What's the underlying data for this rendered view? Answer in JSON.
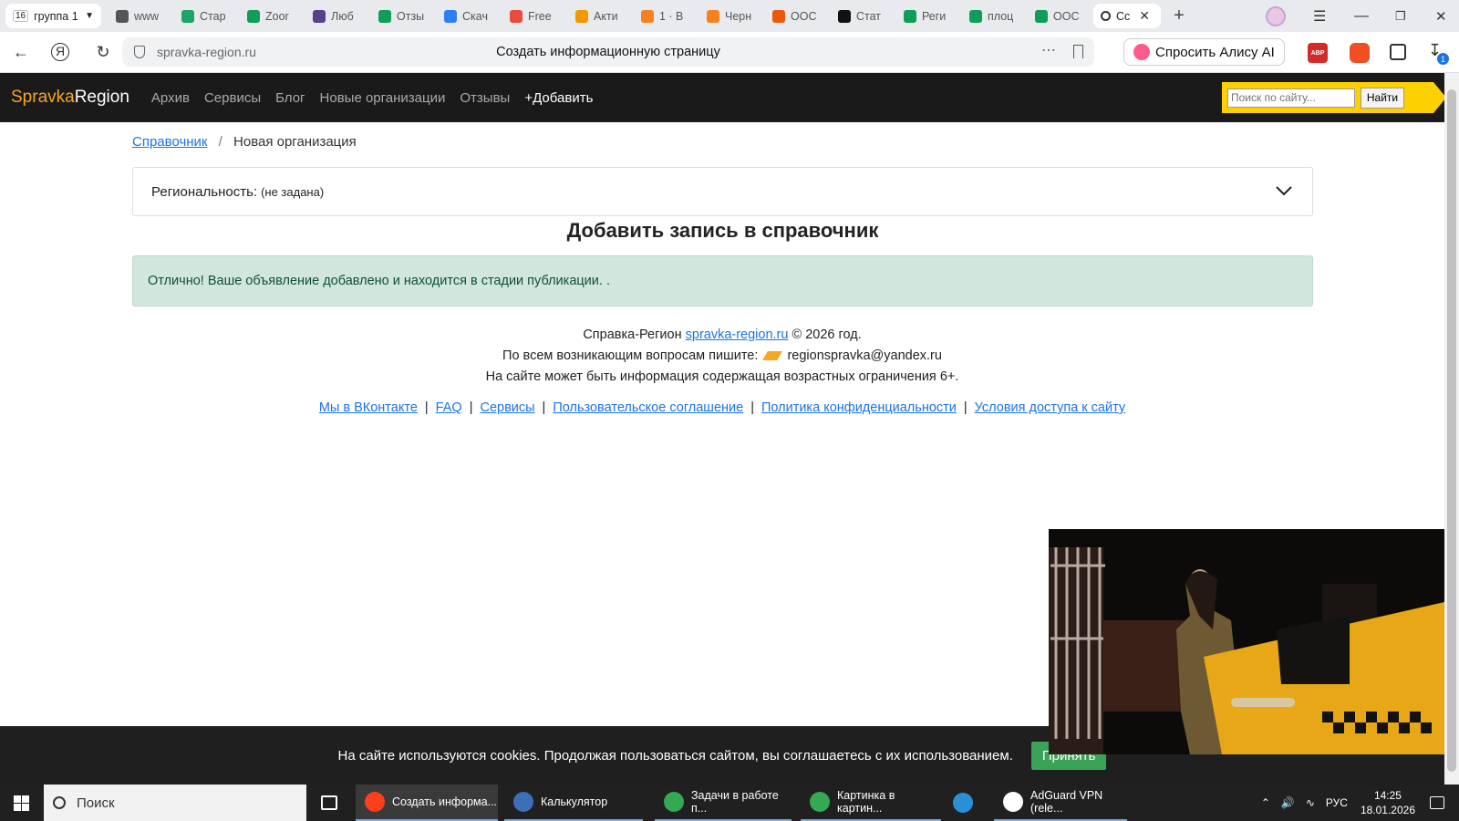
{
  "browser": {
    "tab_group": {
      "count": "16",
      "label": "группа 1"
    },
    "tabs": [
      {
        "label": "www",
        "icon": "doc-icon",
        "color": "#555555"
      },
      {
        "label": "Стар",
        "icon": "drive-icon",
        "color": "#1fa463"
      },
      {
        "label": "Zoor",
        "icon": "sheets-icon",
        "color": "#0f9d58"
      },
      {
        "label": "Люб",
        "icon": "circle-icon",
        "color": "#5b3f8c"
      },
      {
        "label": "Отзы",
        "icon": "sheets-icon",
        "color": "#0f9d58"
      },
      {
        "label": "Скач",
        "icon": "heart-icon",
        "color": "#2d7ff9"
      },
      {
        "label": "Free",
        "icon": "free-icon",
        "color": "#e94b3c"
      },
      {
        "label": "Акти",
        "icon": "chat-icon",
        "color": "#f29900"
      },
      {
        "label": "1 · В",
        "icon": "mail-icon",
        "color": "#f58220"
      },
      {
        "label": "Черн",
        "icon": "mail-icon",
        "color": "#f58220"
      },
      {
        "label": "ООС",
        "icon": "fire-icon",
        "color": "#ea5a0c"
      },
      {
        "label": "Стат",
        "icon": "k-icon",
        "color": "#111111"
      },
      {
        "label": "Реги",
        "icon": "sheets-icon",
        "color": "#0f9d58"
      },
      {
        "label": "плоц",
        "icon": "sheets-icon",
        "color": "#0f9d58"
      },
      {
        "label": "ООС",
        "icon": "sheets-icon",
        "color": "#0f9d58"
      }
    ],
    "active_tab": {
      "label": "Сс",
      "icon": "pin-icon"
    },
    "url": "spravka-region.ru",
    "page_title": "Создать информационную страницу",
    "alisa_label": "Спросить Алису AI",
    "ext_abp": "ABP",
    "downloads_badge": "1"
  },
  "site": {
    "logo_a": "Spravka",
    "logo_b": "Region",
    "nav": [
      "Архив",
      "Сервисы",
      "Блог",
      "Новые организации",
      "Отзывы",
      "+Добавить"
    ],
    "search_placeholder": "Поиск по сайту...",
    "search_button": "Найти",
    "breadcrumb": {
      "home": "Справочник",
      "sep": "/",
      "current": "Новая организация"
    },
    "region_label": "Региональность:",
    "region_value": "(не задана)",
    "heading": "Добавить запись в справочник",
    "alert": "Отлично! Ваше объявление добавлено и находится в стадии публикации. .",
    "footer": {
      "line1_prefix": "Справка-Регион",
      "line1_link": "spravka-region.ru",
      "line1_suffix": "© 2026 год.",
      "line2_prefix": "По всем возникающим вопросам пишите:",
      "email": "regionspravka@yandex.ru",
      "line3": "На сайте может быть информация содержащая возрастных ограничения 6+.",
      "links": [
        "Мы в ВКонтакте",
        "FAQ",
        "Сервисы",
        "Пользовательское соглашение",
        "Политика конфиденциальности",
        "Условия доступа к сайту"
      ],
      "sep": "|"
    },
    "cookie_text": "На сайте используются cookies. Продолжая пользоваться сайтом, вы соглашаетесь с их использованием.",
    "cookie_button": "Принять"
  },
  "taskbar": {
    "search": "Поиск",
    "apps": [
      {
        "label": "Создать информа...",
        "icon": "yandex-icon",
        "color": "#fc3f1d"
      },
      {
        "label": "Калькулятор",
        "icon": "calculator-icon",
        "color": "#3b6fb6"
      },
      {
        "label": "Задачи в работе п...",
        "icon": "chrome-icon",
        "color": "#34a853"
      },
      {
        "label": "Картинка в картин...",
        "icon": "chrome-icon",
        "color": "#34a853"
      },
      {
        "label": "AdGuard VPN (rele...",
        "icon": "adguard-icon",
        "color": "#ffffff"
      }
    ],
    "lang": "РУС",
    "time": "14:25",
    "date": "18.01.2026"
  }
}
